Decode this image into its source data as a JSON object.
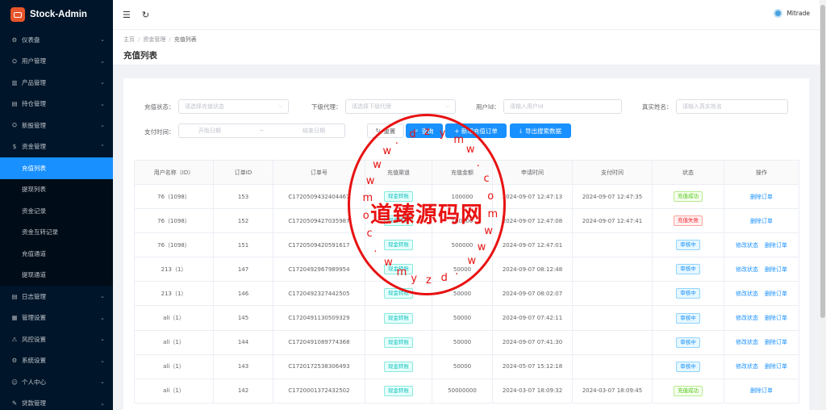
{
  "app": {
    "name": "Stock-Admin"
  },
  "sidebar": {
    "items": [
      {
        "icon": "dashboard-icon",
        "glyph": "⚙",
        "label": "仪表盘",
        "expanded": false
      },
      {
        "icon": "users-icon",
        "glyph": "⛭",
        "label": "用户管理",
        "expanded": false
      },
      {
        "icon": "chart-icon",
        "glyph": "▥",
        "label": "产品管理",
        "expanded": false
      },
      {
        "icon": "holding-icon",
        "glyph": "▤",
        "label": "持仓管理",
        "expanded": false
      },
      {
        "icon": "ipo-icon",
        "glyph": "⛭",
        "label": "新股管理",
        "expanded": false
      },
      {
        "icon": "money-icon",
        "glyph": "$",
        "label": "资金管理",
        "expanded": true
      }
    ],
    "subitems": [
      {
        "label": "充值列表",
        "active": true
      },
      {
        "label": "提现列表",
        "active": false
      },
      {
        "label": "资金记录",
        "active": false
      },
      {
        "label": "资金互转记录",
        "active": false
      },
      {
        "label": "充值通道",
        "active": false
      },
      {
        "label": "提现通道",
        "active": false
      }
    ],
    "items_after": [
      {
        "icon": "log-icon",
        "glyph": "▤",
        "label": "日志管理"
      },
      {
        "icon": "settings-icon",
        "glyph": "▦",
        "label": "管理设置"
      },
      {
        "icon": "risk-icon",
        "glyph": "⚠",
        "label": "风控设置"
      },
      {
        "icon": "system-icon",
        "glyph": "⚙",
        "label": "系统设置"
      },
      {
        "icon": "user-icon",
        "glyph": "☺",
        "label": "个人中心"
      },
      {
        "icon": "loan-icon",
        "glyph": "✎",
        "label": "贷款管理"
      }
    ]
  },
  "topbar": {
    "user_name": "Mitrade"
  },
  "breadcrumb": [
    "主页",
    "资金管理",
    "充值列表"
  ],
  "page_title": "充值列表",
  "filters": {
    "status_label": "充值状态：",
    "status_placeholder": "请选择充值状态",
    "agent_label": "下级代理：",
    "agent_placeholder": "请选择下级代理",
    "userid_label": "用户Id：",
    "userid_placeholder": "请输入用户Id",
    "realname_label": "真实姓名：",
    "realname_placeholder": "请输入真实姓名",
    "time_label": "支付时间：",
    "start_placeholder": "开始日期",
    "range_sep": "~",
    "end_placeholder": "结束日期"
  },
  "buttons": {
    "reset": "重置",
    "search": "查询",
    "add": "+ 新增充值订单",
    "export": "导出搜索数据"
  },
  "table": {
    "columns": [
      "用户名称（ID）",
      "订单ID",
      "订单号",
      "充值渠道",
      "充值金额",
      "申请时间",
      "支付时间",
      "状态",
      "操作"
    ],
    "rows": [
      {
        "user": "76（1098）",
        "order_id": "153",
        "order_no": "C1720509432404467",
        "channel": "现金转账",
        "amount": "100000",
        "apply_time": "2024-09-07 12:47:13",
        "pay_time": "2024-09-07 12:47:35",
        "status": "充值成功",
        "status_type": "success",
        "ops": [
          "删除订单"
        ]
      },
      {
        "user": "76（1098）",
        "order_id": "152",
        "order_no": "C1720509427035987",
        "channel": "现金转账",
        "amount": "100000",
        "apply_time": "2024-09-07 12:47:08",
        "pay_time": "2024-09-07 12:47:41",
        "status": "充值失败",
        "status_type": "fail",
        "ops": [
          "删除订单"
        ]
      },
      {
        "user": "76（1098）",
        "order_id": "151",
        "order_no": "C1720509420591617",
        "channel": "现金转账",
        "amount": "500000",
        "apply_time": "2024-09-07 12:47:01",
        "pay_time": "",
        "status": "审核中",
        "status_type": "review",
        "ops": [
          "修改状态",
          "删除订单"
        ]
      },
      {
        "user": "213（1）",
        "order_id": "147",
        "order_no": "C1720492967989954",
        "channel": "现金转账",
        "amount": "50000",
        "apply_time": "2024-09-07 08:12:48",
        "pay_time": "",
        "status": "审核中",
        "status_type": "review",
        "ops": [
          "修改状态",
          "删除订单"
        ]
      },
      {
        "user": "213（1）",
        "order_id": "146",
        "order_no": "C1720492327442505",
        "channel": "现金转账",
        "amount": "50000",
        "apply_time": "2024-09-07 08:02:07",
        "pay_time": "",
        "status": "审核中",
        "status_type": "review",
        "ops": [
          "修改状态",
          "删除订单"
        ]
      },
      {
        "user": "ali（1）",
        "order_id": "145",
        "order_no": "C1720491130509329",
        "channel": "现金转账",
        "amount": "50000",
        "apply_time": "2024-09-07 07:42:11",
        "pay_time": "",
        "status": "审核中",
        "status_type": "review",
        "ops": [
          "修改状态",
          "删除订单"
        ]
      },
      {
        "user": "ali（1）",
        "order_id": "144",
        "order_no": "C1720491089774368",
        "channel": "现金转账",
        "amount": "50000",
        "apply_time": "2024-09-07 07:41:30",
        "pay_time": "",
        "status": "审核中",
        "status_type": "review",
        "ops": [
          "修改状态",
          "删除订单"
        ]
      },
      {
        "user": "ali（1）",
        "order_id": "143",
        "order_no": "C1720172538306493",
        "channel": "现金转账",
        "amount": "50000",
        "apply_time": "2024-05-07 15:12:18",
        "pay_time": "",
        "status": "审核中",
        "status_type": "review",
        "ops": [
          "修改状态",
          "删除订单"
        ]
      },
      {
        "user": "ali（1）",
        "order_id": "142",
        "order_no": "C1720001372432502",
        "channel": "现金转账",
        "amount": "50000000",
        "apply_time": "2024-03-07 18:09:32",
        "pay_time": "2024-03-07 18:09:45",
        "status": "充值成功",
        "status_type": "success",
        "ops": [
          "删除订单"
        ]
      }
    ]
  },
  "watermark": {
    "main": "道臻源码网",
    "ring_chars": [
      "w",
      "w",
      "w",
      ".",
      "d",
      "z",
      "y",
      "m",
      "w",
      ".",
      "c",
      "o",
      "m",
      "w",
      "w",
      "w",
      ".",
      "d",
      "z",
      "y",
      "m",
      "w",
      ".",
      "c",
      "o",
      "m"
    ]
  },
  "colors": {
    "sidebar_bg": "#001529",
    "accent": "#1890ff",
    "watermark": "#e81212",
    "brand_logo": "#e8552a"
  }
}
